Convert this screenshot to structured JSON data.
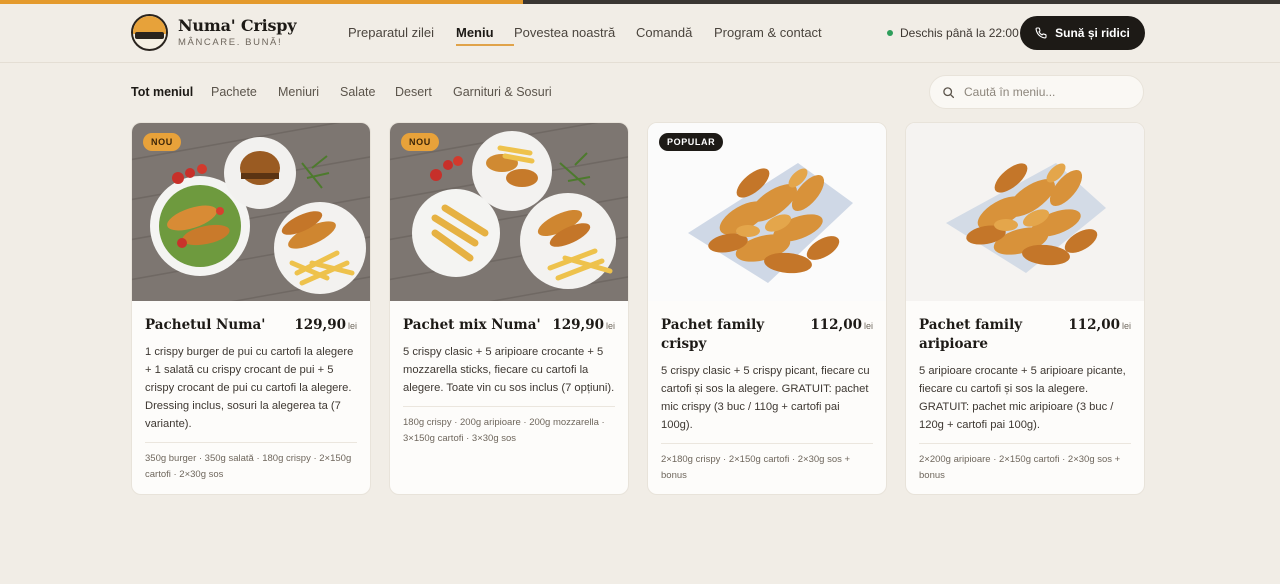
{
  "brand": {
    "name": "Numa' Crispy",
    "tagline": "MÂNCARE. BUNĂ!"
  },
  "nav": [
    {
      "label": "Preparatul zilei",
      "active": false
    },
    {
      "label": "Meniu",
      "active": true
    },
    {
      "label": "Povestea noastră",
      "active": false
    },
    {
      "label": "Comandă",
      "active": false
    },
    {
      "label": "Program & contact",
      "active": false
    }
  ],
  "status": {
    "text": "Deschis până la 22:00",
    "color": "#2e9e5b"
  },
  "call_button": {
    "label": "Sună și ridici",
    "icon": "phone-icon"
  },
  "filters": [
    {
      "label": "Tot meniul",
      "active": true
    },
    {
      "label": "Pachete",
      "active": false
    },
    {
      "label": "Meniuri",
      "active": false
    },
    {
      "label": "Salate",
      "active": false
    },
    {
      "label": "Desert",
      "active": false
    },
    {
      "label": "Garnituri & Sosuri",
      "active": false
    }
  ],
  "search": {
    "placeholder": "Caută în meniu...",
    "value": "",
    "icon": "search-icon"
  },
  "colors": {
    "accent": "#e8a23a",
    "dark": "#1d1a16",
    "background": "#f1ede6"
  },
  "products": [
    {
      "badge": "NOU",
      "title": "Pachetul Numa'",
      "price": "129,90",
      "currency": "lei",
      "description": "1 crispy burger de pui cu cartofi la alegere + 1 salată cu crispy crocant de pui + 5 crispy crocant de pui cu cartofi la alegere. Dressing inclus, sosuri la alegerea ta (7 variante).",
      "meta": "350g burger · 350g salată · 180g crispy · 2×150g cartofi · 2×30g sos"
    },
    {
      "badge": "NOU",
      "title": "Pachet mix Numa'",
      "price": "129,90",
      "currency": "lei",
      "description": "5 crispy clasic + 5 aripioare crocante + 5 mozzarella sticks, fiecare cu cartofi la alegere. Toate vin cu sos inclus (7 opțiuni).",
      "meta": "180g crispy · 200g aripioare · 200g mozzarella · 3×150g cartofi · 3×30g sos"
    },
    {
      "badge": "POPULAR",
      "title": "Pachet family crispy",
      "price": "112,00",
      "currency": "lei",
      "description": "5 crispy clasic + 5 crispy picant, fiecare cu cartofi și sos la alegere. GRATUIT: pachet mic crispy (3 buc / 110g + cartofi pai 100g).",
      "meta": "2×180g crispy · 2×150g cartofi · 2×30g sos + bonus"
    },
    {
      "badge": "",
      "title": "Pachet family aripioare",
      "price": "112,00",
      "currency": "lei",
      "description": "5 aripioare crocante + 5 aripioare picante, fiecare cu cartofi și sos la alegere. GRATUIT: pachet mic aripioare (3 buc / 120g + cartofi pai 100g).",
      "meta": "2×200g aripioare · 2×150g cartofi · 2×30g sos + bonus"
    }
  ]
}
